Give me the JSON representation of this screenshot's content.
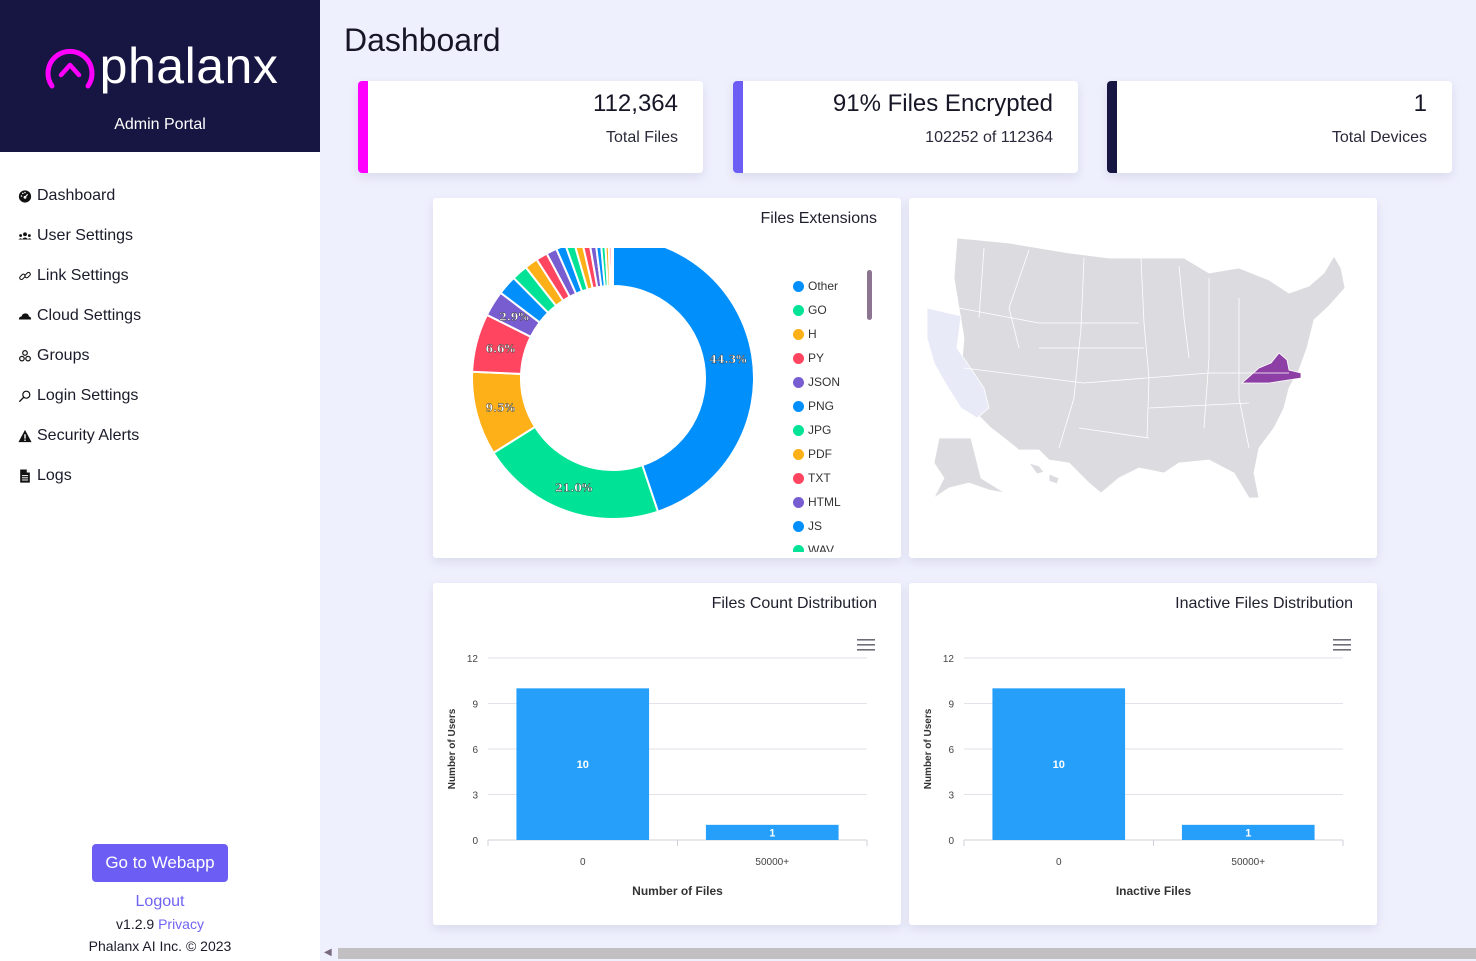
{
  "brand": {
    "name": "phalanx",
    "subtitle": "Admin Portal",
    "logo_icon": "phalanx-arc-chevron-logo",
    "accent": "#ff00ff"
  },
  "sidebar": {
    "items": [
      {
        "label": "Dashboard",
        "icon": "gauge-icon"
      },
      {
        "label": "User Settings",
        "icon": "users-icon"
      },
      {
        "label": "Link Settings",
        "icon": "link-icon"
      },
      {
        "label": "Cloud Settings",
        "icon": "cloud-icon"
      },
      {
        "label": "Groups",
        "icon": "groups-icon"
      },
      {
        "label": "Login Settings",
        "icon": "search-icon"
      },
      {
        "label": "Security Alerts",
        "icon": "warning-icon"
      },
      {
        "label": "Logs",
        "icon": "document-icon"
      }
    ],
    "webapp_button": "Go to Webapp",
    "logout": "Logout",
    "version": "v1.2.9",
    "privacy": "Privacy",
    "copyright": "Phalanx AI Inc. © 2023"
  },
  "page": {
    "title": "Dashboard"
  },
  "stats": [
    {
      "value": "112,364",
      "label": "Total Files",
      "color": "#ff00ff"
    },
    {
      "value": "91% Files Encrypted",
      "label": "102252 of 112364",
      "color": "#6c5ef5"
    },
    {
      "value": "1",
      "label": "Total Devices",
      "color": "#171642"
    }
  ],
  "map": {
    "highlighted_state": "Virginia",
    "highlight_color": "#8e3fa5",
    "secondary_state": "California"
  },
  "chart_data": [
    {
      "type": "pie",
      "title": "Files Extensions",
      "donut": true,
      "slices": [
        {
          "label": "44.3%",
          "value": 44.3,
          "color": "#008ffb"
        },
        {
          "label": "21.0%",
          "value": 21.0,
          "color": "#00e396"
        },
        {
          "label": "9.5%",
          "value": 9.5,
          "color": "#feb019"
        },
        {
          "label": "6.6%",
          "value": 6.6,
          "color": "#ff4560"
        },
        {
          "label": "2.9%",
          "value": 2.9,
          "color": "#775dd0"
        },
        {
          "label": "",
          "value": 2.2,
          "color": "#008ffb"
        },
        {
          "label": "",
          "value": 1.8,
          "color": "#00e396"
        },
        {
          "label": "",
          "value": 1.5,
          "color": "#feb019"
        },
        {
          "label": "",
          "value": 1.3,
          "color": "#ff4560"
        },
        {
          "label": "",
          "value": 1.2,
          "color": "#775dd0"
        },
        {
          "label": "",
          "value": 1.1,
          "color": "#008ffb"
        },
        {
          "label": "",
          "value": 1.0,
          "color": "#00e396"
        },
        {
          "label": "",
          "value": 0.9,
          "color": "#feb019"
        },
        {
          "label": "",
          "value": 0.8,
          "color": "#ff4560"
        },
        {
          "label": "",
          "value": 0.7,
          "color": "#775dd0"
        },
        {
          "label": "",
          "value": 0.6,
          "color": "#008ffb"
        },
        {
          "label": "",
          "value": 0.5,
          "color": "#00e396"
        },
        {
          "label": "",
          "value": 0.4,
          "color": "#feb019"
        },
        {
          "label": "",
          "value": 0.3,
          "color": "#ff4560"
        },
        {
          "label": "",
          "value": 0.2,
          "color": "#775dd0"
        }
      ],
      "legend": [
        {
          "label": "Other",
          "color": "#008ffb"
        },
        {
          "label": "GO",
          "color": "#00e396"
        },
        {
          "label": "H",
          "color": "#feb019"
        },
        {
          "label": "PY",
          "color": "#ff4560"
        },
        {
          "label": "JSON",
          "color": "#775dd0"
        },
        {
          "label": "PNG",
          "color": "#008ffb"
        },
        {
          "label": "JPG",
          "color": "#00e396"
        },
        {
          "label": "PDF",
          "color": "#feb019"
        },
        {
          "label": "TXT",
          "color": "#ff4560"
        },
        {
          "label": "HTML",
          "color": "#775dd0"
        },
        {
          "label": "JS",
          "color": "#008ffb"
        },
        {
          "label": "WAV",
          "color": "#00e396"
        }
      ],
      "legend_position": "right"
    },
    {
      "type": "bar",
      "title": "Files Count Distribution",
      "categories": [
        "0",
        "50000+"
      ],
      "values": [
        10,
        1
      ],
      "xlabel": "Number of Files",
      "ylabel": "Number of Users",
      "ylim": [
        0,
        12
      ],
      "yticks": [
        "0",
        "3",
        "6",
        "9",
        "12"
      ],
      "color": "#269ffb",
      "grid": true
    },
    {
      "type": "bar",
      "title": "Inactive Files Distribution",
      "categories": [
        "0",
        "50000+"
      ],
      "values": [
        10,
        1
      ],
      "xlabel": "Inactive Files",
      "ylabel": "Number of Users",
      "ylim": [
        0,
        12
      ],
      "yticks": [
        "0",
        "3",
        "6",
        "9",
        "12"
      ],
      "color": "#269ffb",
      "grid": true
    }
  ]
}
